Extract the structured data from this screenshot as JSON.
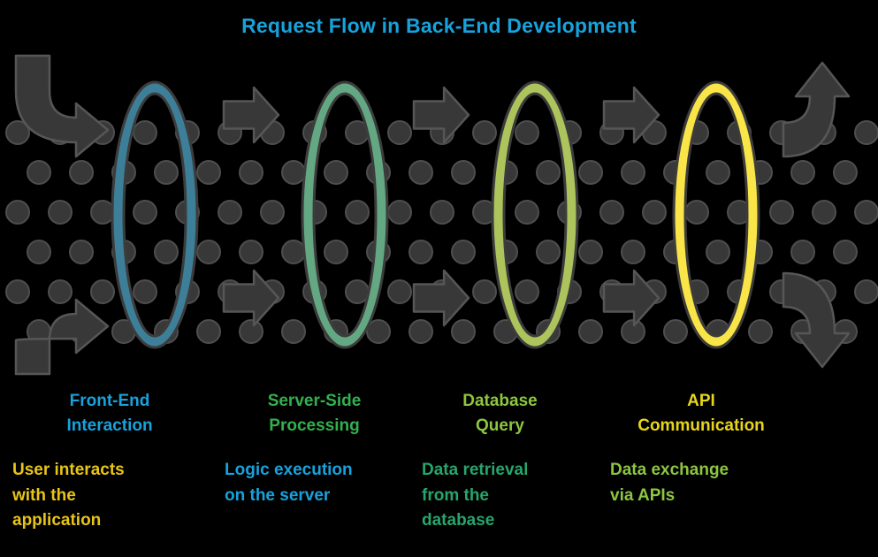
{
  "header": {
    "title": "Request Flow in Back-End Development",
    "title_color": "#17a2dc"
  },
  "theme": {
    "background": "#000000",
    "dot_color": "#383838",
    "dot_stroke": "#4e4e4e",
    "arrow_color": "#383838",
    "arrow_stroke": "#565656",
    "ring_stroke": "#3c3c3c"
  },
  "stages": [
    {
      "id": "front-end-interaction",
      "ring_color": "#3d7f99",
      "heading": "Front-End\nInteraction",
      "heading_color": "#17a2dc",
      "description": "User interacts\nwith the\napplication",
      "description_color": "#e8c417"
    },
    {
      "id": "server-side-processing",
      "ring_color": "#63a883",
      "heading": "Server-Side\nProcessing",
      "heading_color": "#33b04e",
      "description": "Logic execution\non the server",
      "description_color": "#17a2dc"
    },
    {
      "id": "database-query",
      "ring_color": "#adc45c",
      "heading": "Database\nQuery",
      "heading_color": "#8cc63f",
      "description": "Data retrieval\nfrom the\ndatabase",
      "description_color": "#27a56b"
    },
    {
      "id": "api-communication",
      "ring_color": "#f9e547",
      "heading": "API\nCommunication",
      "heading_color": "#e8d51a",
      "description": "Data exchange\nvia APIs",
      "description_color": "#8cc63f"
    }
  ],
  "connectors": {
    "straight_arrows": [
      {
        "name": "arrow-front-end-to-server-top"
      },
      {
        "name": "arrow-front-end-to-server-bottom"
      },
      {
        "name": "arrow-server-to-database-top"
      },
      {
        "name": "arrow-server-to-database-bottom"
      },
      {
        "name": "arrow-database-to-api-top"
      },
      {
        "name": "arrow-database-to-api-bottom"
      }
    ],
    "curved_arrows": [
      {
        "name": "arrow-inbound-top-left"
      },
      {
        "name": "arrow-inbound-bottom-left"
      },
      {
        "name": "arrow-outbound-top-right"
      },
      {
        "name": "arrow-outbound-bottom-right"
      }
    ]
  }
}
